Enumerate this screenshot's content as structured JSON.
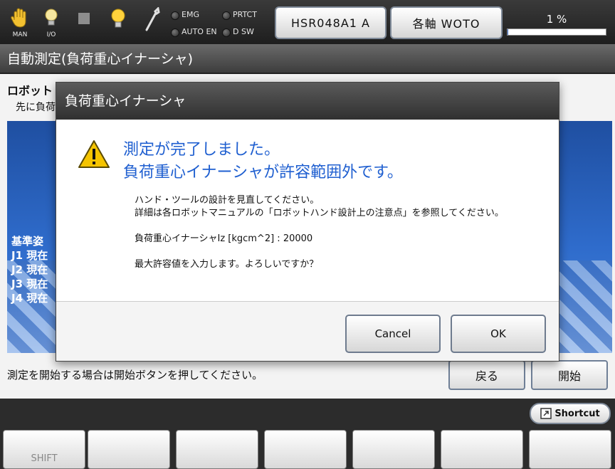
{
  "status_bar": {
    "icons": [
      {
        "name": "hand-icon",
        "caption": "MAN"
      },
      {
        "name": "bulb-icon",
        "caption": "I/O"
      },
      {
        "name": "stop-square-icon",
        "caption": ""
      },
      {
        "name": "lamp-icon",
        "caption": ""
      },
      {
        "name": "wrench-icon",
        "caption": ""
      }
    ],
    "indicators": {
      "emg": "EMG",
      "prtct": "PRTCT",
      "auto_en": "AUTO EN",
      "dsw": "D SW"
    },
    "robot_button": "HSR048A1 A",
    "axis_button": "各軸 WOTO",
    "progress_text": "1 %",
    "progress_value": 0.01,
    "colors": {
      "progress": "#3c6fd0"
    }
  },
  "title_bar": {
    "title": "自動測定(負荷重心イナーシャ)"
  },
  "main": {
    "heading1": "ロボット",
    "heading2": "先に負荷",
    "overlay": [
      "基準姿",
      "J1 現在",
      "J2 現在",
      "J3 現在",
      "J4 現在"
    ],
    "footer_text": "測定を開始する場合は開始ボタンを押してください。",
    "back_button": "戻る",
    "start_button": "開始"
  },
  "bottom_bar": {
    "shortcut_label": "Shortcut",
    "fkeys": [
      "SHIFT",
      "",
      "",
      "",
      "",
      "",
      ""
    ]
  },
  "dialog": {
    "title": "負荷重心イナーシャ",
    "message_line1": "測定が完了しました。",
    "message_line2": "負荷重心イナーシャが許容範囲外です。",
    "detail_line1": "ハンド・ツールの設計を見直してください。",
    "detail_line2": "詳細は各ロボットマニュアルの「ロボットハンド設計上の注意点」を参照してください。",
    "value_line": "負荷重心イナーシャIz [kgcm^2] : 20000",
    "question": "最大許容値を入力します。よろしいですか？",
    "cancel_button": "Cancel",
    "ok_button": "OK"
  }
}
